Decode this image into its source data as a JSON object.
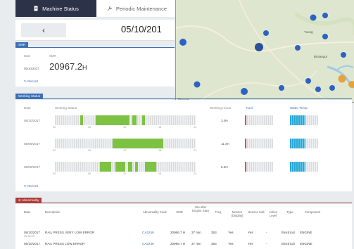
{
  "tabs": [
    {
      "label": "Machine Status",
      "icon": "document-icon",
      "active": true
    },
    {
      "label": "Periodic Maintenance",
      "icon": "wrench-icon",
      "active": false
    }
  ],
  "datebar": {
    "back_icon": "chevron-left",
    "date": "05/10/201"
  },
  "smr": {
    "section_label": "SMR",
    "col_date": "Date",
    "col_smr": "SMR",
    "date": "05/10/2017",
    "value": "20967.2",
    "unit": "H",
    "record_label": "Record"
  },
  "working_status": {
    "section_label": "Working Status",
    "col_date": "Date",
    "col_status": "Working Status",
    "col_hours": "Working Hours",
    "col_fuel": "Fuel",
    "col_water": "Water Temp.",
    "ticks": [
      "00",
      "06",
      "12",
      "18",
      "24"
    ],
    "rows": [
      {
        "date": "05/10/2017",
        "hours": "3.0H",
        "segments": [
          [
            0.18,
            0.2
          ],
          [
            0.29,
            0.53
          ],
          [
            0.55,
            0.58
          ],
          [
            0.62,
            0.64
          ]
        ]
      },
      {
        "date": "05/09/2017",
        "hours": "11.4H",
        "segments": [
          [
            0.41,
            0.77
          ]
        ]
      },
      {
        "date": "05/08/2017",
        "hours": "5.9H",
        "segments": [
          [
            0.32,
            0.4
          ],
          [
            0.43,
            0.5
          ],
          [
            0.52,
            0.55
          ],
          [
            0.57,
            0.59
          ],
          [
            0.64,
            0.72
          ]
        ]
      }
    ],
    "record_label": "Record"
  },
  "abnormality": {
    "section_label": "Abnormality",
    "headers": [
      "Date",
      "Description",
      "Abnormality Code",
      "SMR",
      "Into after Engine Start",
      "Freq",
      "Monitor (Display)",
      "Service Call",
      "Action Level",
      "Type",
      "Component"
    ],
    "rows": [
      {
        "date": "05/10/2017",
        "date_sub": "05:38:00",
        "desc": "RAIL PRESS VERY LOW ERROR",
        "code": "CA2249",
        "smr": "20966.7 H",
        "into": "37 min",
        "freq": "353",
        "monitor": "Yes",
        "service": "Yes",
        "action": "-",
        "type": "Electrical",
        "component": "ENGINE"
      },
      {
        "date": "05/10/2017",
        "date_sub": "",
        "desc": "RAIL PRESS LOW ERROR",
        "code": "CA2249",
        "smr": "20966.7 H",
        "into": "37 min",
        "freq": "353",
        "monitor": "Yes",
        "service": "Yes",
        "action": "-",
        "type": "Electrical",
        "component": "ENGINE"
      }
    ]
  },
  "map": {
    "labels": [
      "Tuong",
      "Bintangor"
    ],
    "google": "Google",
    "markers_blue": 12,
    "markers_orange": 2
  },
  "colors": {
    "tab_active": "#2c3349",
    "section_blue": "#3b6fb6",
    "section_red": "#b03a3a",
    "working_green": "#7dc242",
    "fuel_red": "#d9534f",
    "water_cyan": "#29a8d8",
    "link": "#3f6fb6"
  }
}
